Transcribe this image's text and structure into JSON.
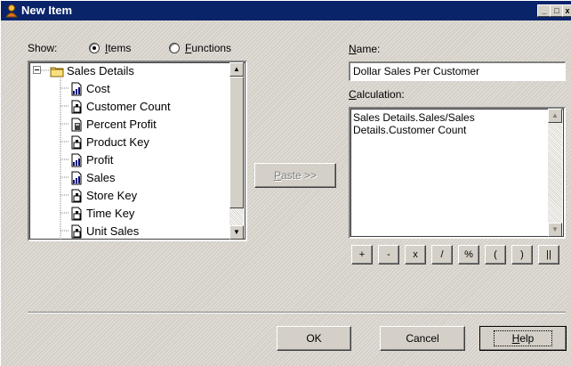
{
  "window": {
    "title": "New Item",
    "controls": [
      "_",
      "□",
      "x"
    ]
  },
  "show": {
    "label": "Show:",
    "options": [
      {
        "label": "Items",
        "accel": "I",
        "rest": "tems",
        "selected": true
      },
      {
        "label": "Functions",
        "accel": "F",
        "rest": "unctions",
        "selected": false
      }
    ]
  },
  "tree": {
    "root": {
      "label": "Sales Details",
      "expander": "−",
      "icon": "folder-icon"
    },
    "items": [
      {
        "label": "Cost",
        "icon": "numeric-item-icon"
      },
      {
        "label": "Customer Count",
        "icon": "key-item-icon"
      },
      {
        "label": "Percent Profit",
        "icon": "calc-item-icon"
      },
      {
        "label": "Product Key",
        "icon": "key-item-icon"
      },
      {
        "label": "Profit",
        "icon": "numeric-item-icon"
      },
      {
        "label": "Sales",
        "icon": "numeric-item-icon"
      },
      {
        "label": "Store Key",
        "icon": "key-item-icon"
      },
      {
        "label": "Time Key",
        "icon": "key-item-icon"
      },
      {
        "label": "Unit Sales",
        "icon": "key-item-icon"
      }
    ]
  },
  "paste_button": {
    "accel": "P",
    "rest": "aste >>",
    "enabled": false
  },
  "name_field": {
    "label_accel": "N",
    "label_rest": "ame:",
    "value": "Dollar Sales Per Customer"
  },
  "calculation": {
    "label_accel": "C",
    "label_rest": "alculation:",
    "value": "Sales Details.Sales/Sales Details.Customer Count"
  },
  "operators": [
    "+",
    "-",
    "x",
    "/",
    "%",
    "(",
    ")",
    "||"
  ],
  "buttons": {
    "ok": "OK",
    "cancel": "Cancel",
    "help_accel": "H",
    "help_rest": "elp"
  },
  "colors": {
    "titlebar": "#0a246a",
    "face": "#d4d0c8"
  }
}
